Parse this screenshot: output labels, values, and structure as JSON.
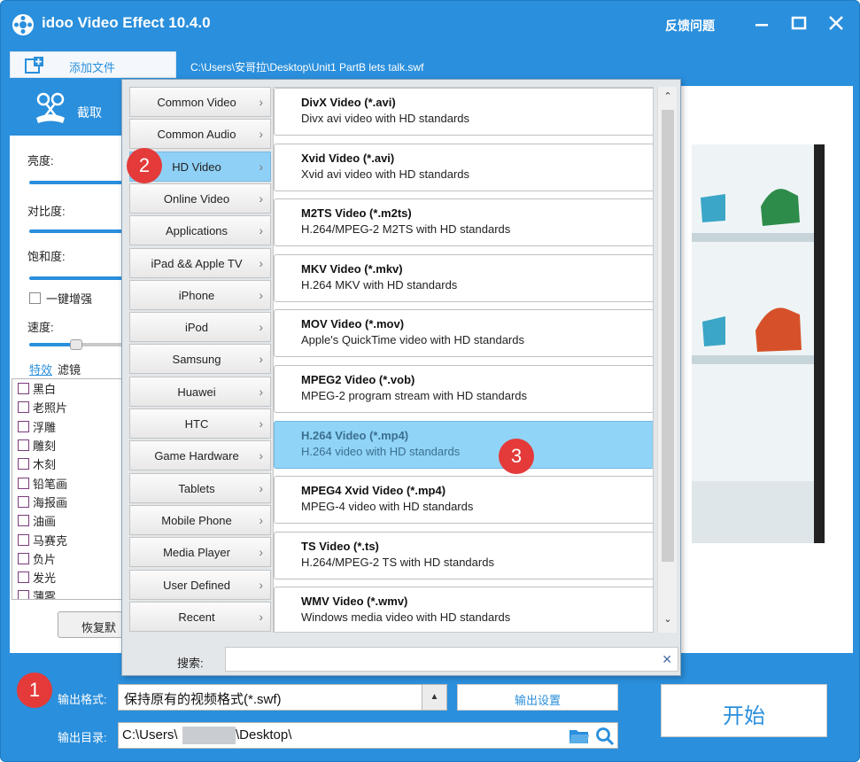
{
  "app": {
    "title": "idoo Video Effect 10.4.0",
    "feedback": "反馈问题"
  },
  "toolbar": {
    "add_file": "添加文件",
    "file_path": "C:\\Users\\安哥拉\\Desktop\\Unit1 PartB lets talk.swf"
  },
  "left_panel": {
    "crop_label": "截取",
    "adjustments": [
      {
        "label": "亮度:",
        "level_percent": 100
      },
      {
        "label": "对比度:",
        "level_percent": 100
      },
      {
        "label": "饱和度:",
        "level_percent": 100
      }
    ],
    "enhance_label": "一键增强",
    "speed_label": "速度:",
    "tabs": [
      "特效",
      "滤镜"
    ],
    "effects": [
      "黑白",
      "老照片",
      "浮雕",
      "雕刻",
      "木刻",
      "铅笔画",
      "海报画",
      "油画",
      "马赛克",
      "负片",
      "发光",
      "薄雾"
    ],
    "reset_label": "恢复默"
  },
  "dropdown": {
    "categories": [
      "Common Video",
      "Common Audio",
      "HD Video",
      "Online Video",
      "Applications",
      "iPad && Apple TV",
      "iPhone",
      "iPod",
      "Samsung",
      "Huawei",
      "HTC",
      "Game Hardware",
      "Tablets",
      "Mobile Phone",
      "Media Player",
      "User Defined",
      "Recent"
    ],
    "active_category": "HD Video",
    "formats": [
      {
        "title": "DivX Video (*.avi)",
        "desc": "Divx avi video with HD standards"
      },
      {
        "title": "Xvid Video (*.avi)",
        "desc": "Xvid avi video with HD standards"
      },
      {
        "title": "M2TS Video (*.m2ts)",
        "desc": "H.264/MPEG-2 M2TS with HD standards"
      },
      {
        "title": "MKV Video (*.mkv)",
        "desc": "H.264 MKV with HD standards"
      },
      {
        "title": "MOV Video (*.mov)",
        "desc": "Apple's QuickTime video with HD standards"
      },
      {
        "title": "MPEG2 Video (*.vob)",
        "desc": "MPEG-2 program stream with HD standards"
      },
      {
        "title": "H.264 Video (*.mp4)",
        "desc": "H.264 video with HD standards"
      },
      {
        "title": "MPEG4 Xvid Video (*.mp4)",
        "desc": "MPEG-4 video with HD standards"
      },
      {
        "title": "TS Video (*.ts)",
        "desc": "H.264/MPEG-2 TS with HD standards"
      },
      {
        "title": "WMV Video (*.wmv)",
        "desc": "Windows media video with HD standards"
      }
    ],
    "active_format": "H.264 Video (*.mp4)",
    "search_label": "搜索:",
    "search_value": ""
  },
  "bottom": {
    "format_label": "输出格式:",
    "format_value": "保持原有的视频格式(*.swf)",
    "settings_label": "输出设置",
    "dir_label": "输出目录:",
    "dir_prefix": "C:\\Users\\",
    "dir_suffix": "\\Desktop\\",
    "start_label": "开始"
  },
  "badges": [
    "1",
    "2",
    "3"
  ],
  "colors": {
    "primary": "#2a8fdc",
    "highlight": "#90d4f7",
    "badge": "#e43a3a"
  }
}
